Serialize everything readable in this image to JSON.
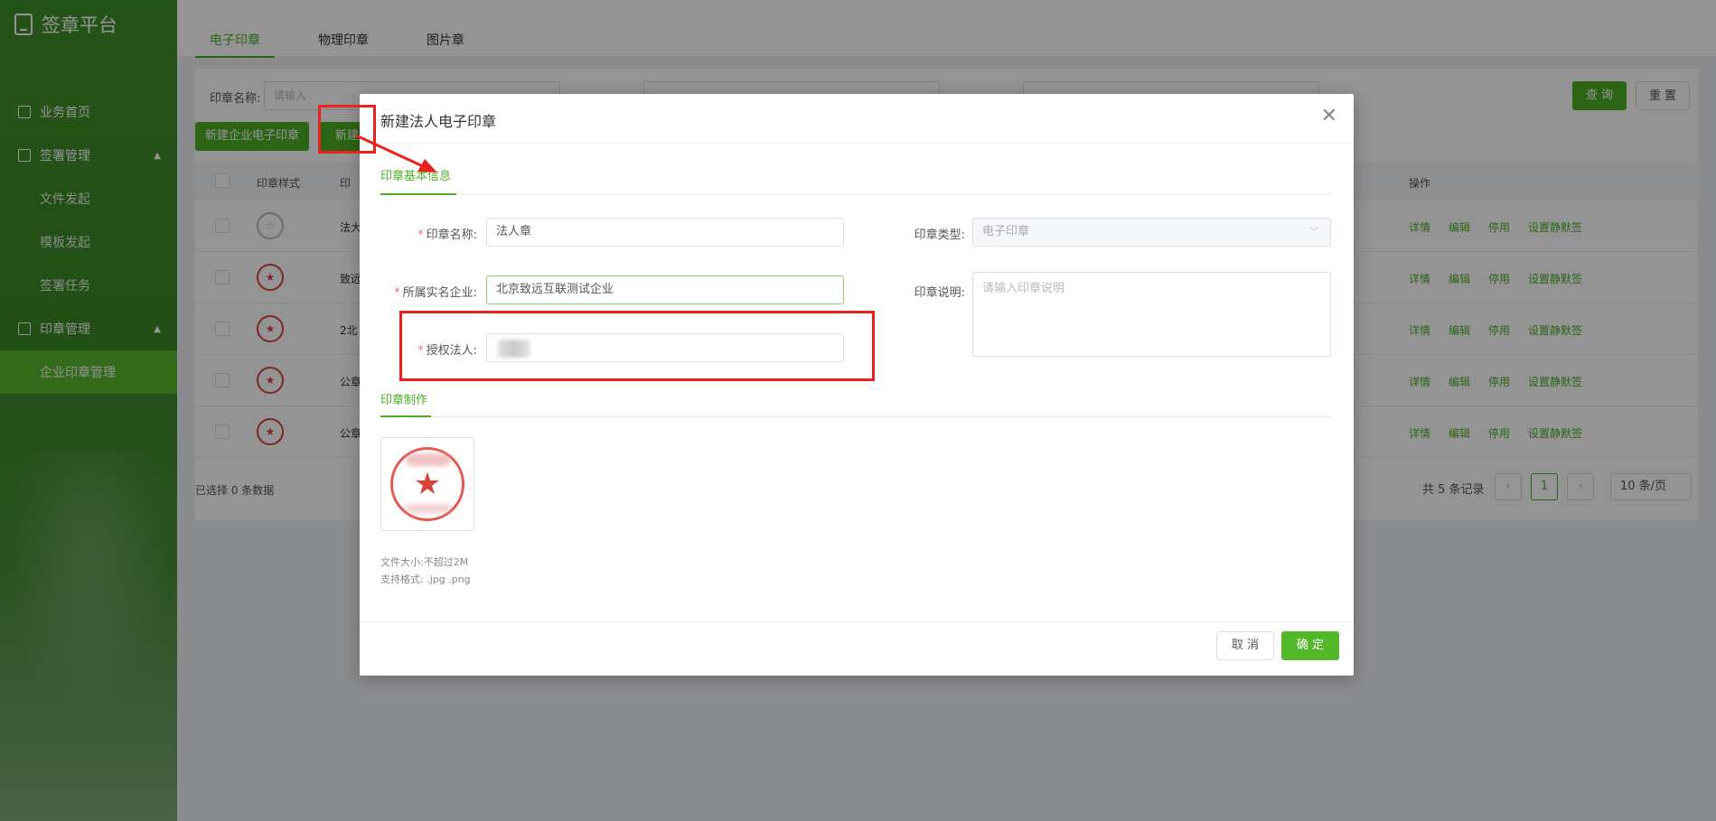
{
  "sidebar": {
    "app_title": "签章平台",
    "menu": [
      {
        "label": "业务首页",
        "icon": "home-icon"
      },
      {
        "label": "签署管理",
        "icon": "sign-icon",
        "expanded": true,
        "children": [
          "文件发起",
          "模板发起",
          "签署任务"
        ]
      },
      {
        "label": "印章管理",
        "icon": "stamp-icon",
        "expanded": true,
        "children": [
          "企业印章管理"
        ]
      }
    ],
    "active_item": "企业印章管理"
  },
  "page": {
    "tabs": [
      "电子印章",
      "物理印章",
      "图片章"
    ],
    "active_tab": "电子印章",
    "filters": {
      "seal_name_label": "印章名称:",
      "seal_name_placeholder": "请输入"
    },
    "buttons": {
      "query": "查 询",
      "reset": "重 置",
      "new_enterprise": "新建企业电子印章",
      "new_legal_partial": "新建"
    },
    "table": {
      "headers": {
        "style": "印章样式",
        "name_partial": "印",
        "ops": "操作"
      },
      "rows": [
        {
          "name_partial": "法大",
          "seal_color": "grey"
        },
        {
          "name_partial": "致远",
          "seal_color": "red"
        },
        {
          "name_partial": "2北",
          "seal_color": "red"
        },
        {
          "name_partial": "公章",
          "seal_color": "red"
        },
        {
          "name_partial": "公章",
          "seal_color": "red"
        }
      ],
      "row_actions": [
        "详情",
        "编辑",
        "停用",
        "设置静默签"
      ]
    },
    "selected_text": "已选择 0 条数据",
    "pagination": {
      "total_text": "共 5 条记录",
      "current_page": "1",
      "page_size": "10 条/页"
    }
  },
  "modal": {
    "title": "新建法人电子印章",
    "close_icon": "close-icon",
    "section_basic": "印章基本信息",
    "section_make": "印章制作",
    "fields": {
      "seal_name_label": "印章名称:",
      "seal_name_value": "法人章",
      "company_label": "所属实名企业:",
      "company_value": "北京致远互联测试企业",
      "legal_label": "授权法人:",
      "seal_type_label": "印章类型:",
      "seal_type_value": "电子印章",
      "desc_label": "印章说明:",
      "desc_placeholder": "请输入印章说明"
    },
    "hints": {
      "size": "文件大小:不超过2M",
      "format": "支持格式: .jpg .png"
    },
    "buttons": {
      "cancel": "取 消",
      "ok": "确 定"
    }
  },
  "colors": {
    "accent": "#4cae27",
    "sidebar": "#3f8f2a",
    "annotation": "#e8231b",
    "required": "#f56c6c",
    "seal": "#d9443a"
  }
}
